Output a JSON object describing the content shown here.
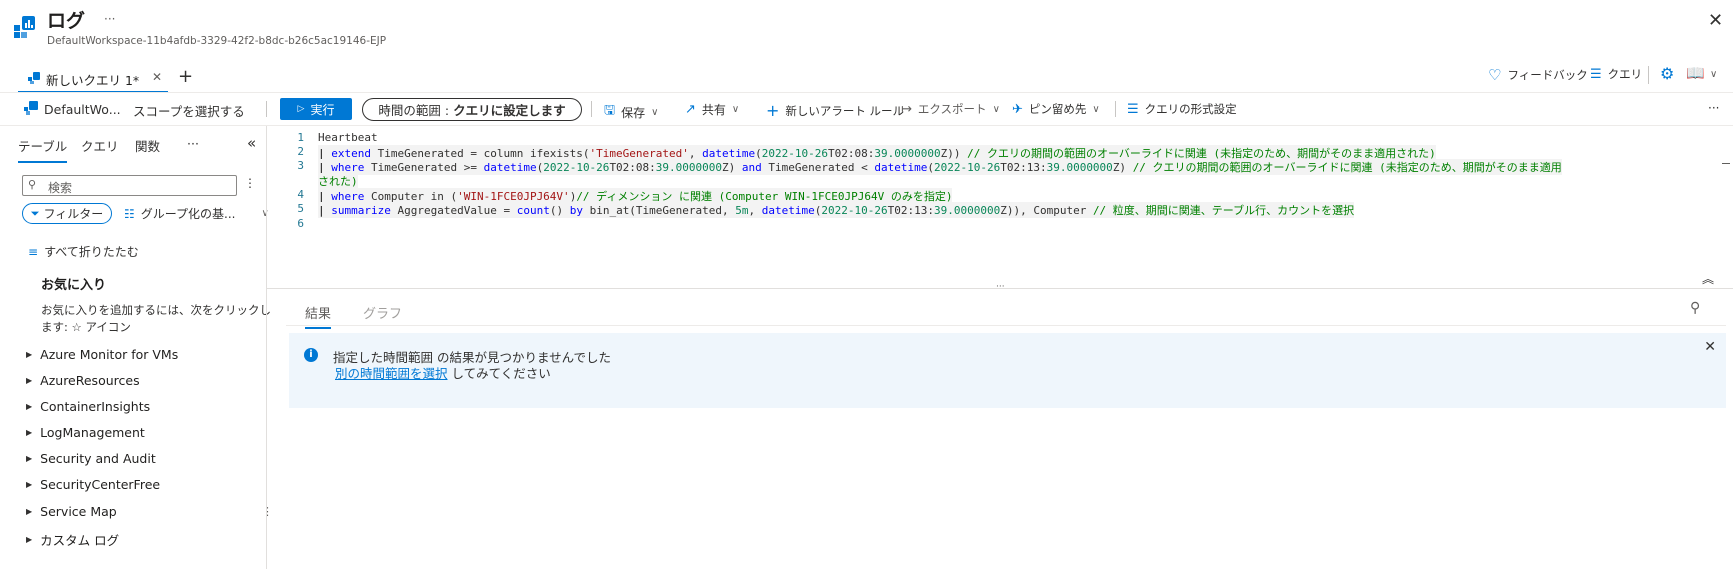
{
  "header": {
    "title": "ログ",
    "more": "···",
    "subtitle": "DefaultWorkspace-11b4afdb-3329-42f2-b8dc-b26c5ac19146-EJP",
    "close": "✕"
  },
  "tabs": {
    "active_label": "新しいクエリ 1*",
    "close": "✕",
    "add": "+"
  },
  "top_right": {
    "feedback": "フィードバック",
    "queries": "クエリ"
  },
  "toolbar": {
    "scope_name": "DefaultWo...",
    "select_scope": "スコープを選択する",
    "run": "実行",
    "time_range_label": "時間の範囲 :",
    "time_range_value": "クエリに設定します",
    "save": "保存",
    "share": "共有",
    "new_alert": "新しいアラート ルール",
    "export": "エクスポート",
    "pin": "ピン留め先",
    "format": "クエリの形式設定",
    "more": "···"
  },
  "left_panel": {
    "tabs": [
      "テーブル",
      "クエリ",
      "関数",
      "···"
    ],
    "collapse": "«",
    "search_placeholder": "検索",
    "filter": "フィルター",
    "group_by": "グループ化の基...",
    "collapse_all": "すべて折りたたむ",
    "favorites_title": "お気に入り",
    "favorites_hint_1": "お気に入りを追加するには、次をクリックし",
    "favorites_hint_2": "ます: ☆ アイコン",
    "tree": [
      "Azure Monitor for VMs",
      "AzureResources",
      "ContainerInsights",
      "LogManagement",
      "Security and Audit",
      "SecurityCenterFree",
      "Service Map",
      "カスタム ログ"
    ]
  },
  "editor": {
    "line_numbers": [
      "1",
      "2",
      "3",
      "",
      "4",
      "5",
      "6"
    ]
  },
  "results": {
    "tab_results": "結果",
    "tab_chart": "グラフ",
    "msg_line1": "指定した時間範囲 の結果が見つかりませんでした",
    "msg_link": "別の時間範囲を選択",
    "msg_rest": " してみてください"
  },
  "colors": {
    "accent": "#0078d4",
    "info_bg": "#eff6fc"
  }
}
